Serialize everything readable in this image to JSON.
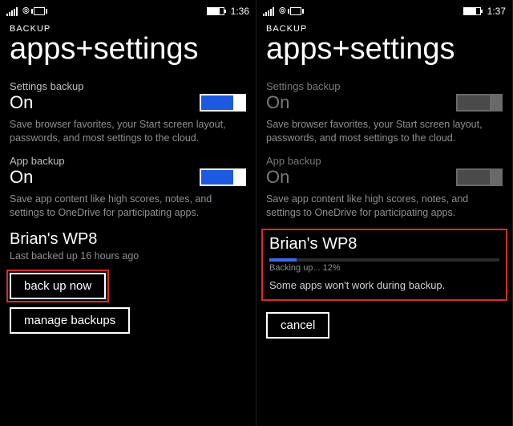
{
  "left": {
    "status": {
      "time": "1:36"
    },
    "crumb": "BACKUP",
    "title": "apps+settings",
    "settings_backup": {
      "label": "Settings backup",
      "value": "On",
      "desc": "Save browser favorites, your Start screen layout, passwords, and most settings to the cloud."
    },
    "app_backup": {
      "label": "App backup",
      "value": "On",
      "desc": "Save app content like high scores, notes, and settings to OneDrive for participating apps."
    },
    "device": {
      "name": "Brian's WP8",
      "sub": "Last backed up 16 hours ago"
    },
    "buttons": {
      "backup_now": "back up now",
      "manage": "manage backups"
    }
  },
  "right": {
    "status": {
      "time": "1:37"
    },
    "crumb": "BACKUP",
    "title": "apps+settings",
    "settings_backup": {
      "label": "Settings backup",
      "value": "On",
      "desc": "Save browser favorites, your Start screen layout, passwords, and most settings to the cloud."
    },
    "app_backup": {
      "label": "App backup",
      "value": "On",
      "desc": "Save app content like high scores, notes, and settings to OneDrive for participating apps."
    },
    "device": {
      "name": "Brian's WP8",
      "progress_text": "Backing up... 12%",
      "progress_pct": 12,
      "note": "Some apps won't work during backup."
    },
    "buttons": {
      "cancel": "cancel"
    }
  }
}
